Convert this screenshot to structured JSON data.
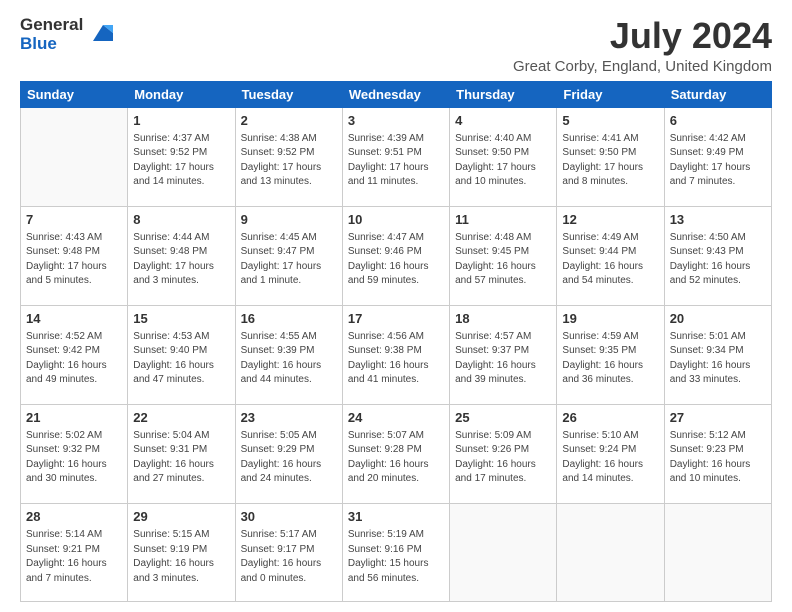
{
  "header": {
    "logo_general": "General",
    "logo_blue": "Blue",
    "title": "July 2024",
    "subtitle": "Great Corby, England, United Kingdom"
  },
  "calendar": {
    "headers": [
      "Sunday",
      "Monday",
      "Tuesday",
      "Wednesday",
      "Thursday",
      "Friday",
      "Saturday"
    ],
    "rows": [
      [
        {
          "day": "",
          "sunrise": "",
          "sunset": "",
          "daylight": ""
        },
        {
          "day": "1",
          "sunrise": "Sunrise: 4:37 AM",
          "sunset": "Sunset: 9:52 PM",
          "daylight": "Daylight: 17 hours and 14 minutes."
        },
        {
          "day": "2",
          "sunrise": "Sunrise: 4:38 AM",
          "sunset": "Sunset: 9:52 PM",
          "daylight": "Daylight: 17 hours and 13 minutes."
        },
        {
          "day": "3",
          "sunrise": "Sunrise: 4:39 AM",
          "sunset": "Sunset: 9:51 PM",
          "daylight": "Daylight: 17 hours and 11 minutes."
        },
        {
          "day": "4",
          "sunrise": "Sunrise: 4:40 AM",
          "sunset": "Sunset: 9:50 PM",
          "daylight": "Daylight: 17 hours and 10 minutes."
        },
        {
          "day": "5",
          "sunrise": "Sunrise: 4:41 AM",
          "sunset": "Sunset: 9:50 PM",
          "daylight": "Daylight: 17 hours and 8 minutes."
        },
        {
          "day": "6",
          "sunrise": "Sunrise: 4:42 AM",
          "sunset": "Sunset: 9:49 PM",
          "daylight": "Daylight: 17 hours and 7 minutes."
        }
      ],
      [
        {
          "day": "7",
          "sunrise": "Sunrise: 4:43 AM",
          "sunset": "Sunset: 9:48 PM",
          "daylight": "Daylight: 17 hours and 5 minutes."
        },
        {
          "day": "8",
          "sunrise": "Sunrise: 4:44 AM",
          "sunset": "Sunset: 9:48 PM",
          "daylight": "Daylight: 17 hours and 3 minutes."
        },
        {
          "day": "9",
          "sunrise": "Sunrise: 4:45 AM",
          "sunset": "Sunset: 9:47 PM",
          "daylight": "Daylight: 17 hours and 1 minute."
        },
        {
          "day": "10",
          "sunrise": "Sunrise: 4:47 AM",
          "sunset": "Sunset: 9:46 PM",
          "daylight": "Daylight: 16 hours and 59 minutes."
        },
        {
          "day": "11",
          "sunrise": "Sunrise: 4:48 AM",
          "sunset": "Sunset: 9:45 PM",
          "daylight": "Daylight: 16 hours and 57 minutes."
        },
        {
          "day": "12",
          "sunrise": "Sunrise: 4:49 AM",
          "sunset": "Sunset: 9:44 PM",
          "daylight": "Daylight: 16 hours and 54 minutes."
        },
        {
          "day": "13",
          "sunrise": "Sunrise: 4:50 AM",
          "sunset": "Sunset: 9:43 PM",
          "daylight": "Daylight: 16 hours and 52 minutes."
        }
      ],
      [
        {
          "day": "14",
          "sunrise": "Sunrise: 4:52 AM",
          "sunset": "Sunset: 9:42 PM",
          "daylight": "Daylight: 16 hours and 49 minutes."
        },
        {
          "day": "15",
          "sunrise": "Sunrise: 4:53 AM",
          "sunset": "Sunset: 9:40 PM",
          "daylight": "Daylight: 16 hours and 47 minutes."
        },
        {
          "day": "16",
          "sunrise": "Sunrise: 4:55 AM",
          "sunset": "Sunset: 9:39 PM",
          "daylight": "Daylight: 16 hours and 44 minutes."
        },
        {
          "day": "17",
          "sunrise": "Sunrise: 4:56 AM",
          "sunset": "Sunset: 9:38 PM",
          "daylight": "Daylight: 16 hours and 41 minutes."
        },
        {
          "day": "18",
          "sunrise": "Sunrise: 4:57 AM",
          "sunset": "Sunset: 9:37 PM",
          "daylight": "Daylight: 16 hours and 39 minutes."
        },
        {
          "day": "19",
          "sunrise": "Sunrise: 4:59 AM",
          "sunset": "Sunset: 9:35 PM",
          "daylight": "Daylight: 16 hours and 36 minutes."
        },
        {
          "day": "20",
          "sunrise": "Sunrise: 5:01 AM",
          "sunset": "Sunset: 9:34 PM",
          "daylight": "Daylight: 16 hours and 33 minutes."
        }
      ],
      [
        {
          "day": "21",
          "sunrise": "Sunrise: 5:02 AM",
          "sunset": "Sunset: 9:32 PM",
          "daylight": "Daylight: 16 hours and 30 minutes."
        },
        {
          "day": "22",
          "sunrise": "Sunrise: 5:04 AM",
          "sunset": "Sunset: 9:31 PM",
          "daylight": "Daylight: 16 hours and 27 minutes."
        },
        {
          "day": "23",
          "sunrise": "Sunrise: 5:05 AM",
          "sunset": "Sunset: 9:29 PM",
          "daylight": "Daylight: 16 hours and 24 minutes."
        },
        {
          "day": "24",
          "sunrise": "Sunrise: 5:07 AM",
          "sunset": "Sunset: 9:28 PM",
          "daylight": "Daylight: 16 hours and 20 minutes."
        },
        {
          "day": "25",
          "sunrise": "Sunrise: 5:09 AM",
          "sunset": "Sunset: 9:26 PM",
          "daylight": "Daylight: 16 hours and 17 minutes."
        },
        {
          "day": "26",
          "sunrise": "Sunrise: 5:10 AM",
          "sunset": "Sunset: 9:24 PM",
          "daylight": "Daylight: 16 hours and 14 minutes."
        },
        {
          "day": "27",
          "sunrise": "Sunrise: 5:12 AM",
          "sunset": "Sunset: 9:23 PM",
          "daylight": "Daylight: 16 hours and 10 minutes."
        }
      ],
      [
        {
          "day": "28",
          "sunrise": "Sunrise: 5:14 AM",
          "sunset": "Sunset: 9:21 PM",
          "daylight": "Daylight: 16 hours and 7 minutes."
        },
        {
          "day": "29",
          "sunrise": "Sunrise: 5:15 AM",
          "sunset": "Sunset: 9:19 PM",
          "daylight": "Daylight: 16 hours and 3 minutes."
        },
        {
          "day": "30",
          "sunrise": "Sunrise: 5:17 AM",
          "sunset": "Sunset: 9:17 PM",
          "daylight": "Daylight: 16 hours and 0 minutes."
        },
        {
          "day": "31",
          "sunrise": "Sunrise: 5:19 AM",
          "sunset": "Sunset: 9:16 PM",
          "daylight": "Daylight: 15 hours and 56 minutes."
        },
        {
          "day": "",
          "sunrise": "",
          "sunset": "",
          "daylight": ""
        },
        {
          "day": "",
          "sunrise": "",
          "sunset": "",
          "daylight": ""
        },
        {
          "day": "",
          "sunrise": "",
          "sunset": "",
          "daylight": ""
        }
      ]
    ]
  }
}
